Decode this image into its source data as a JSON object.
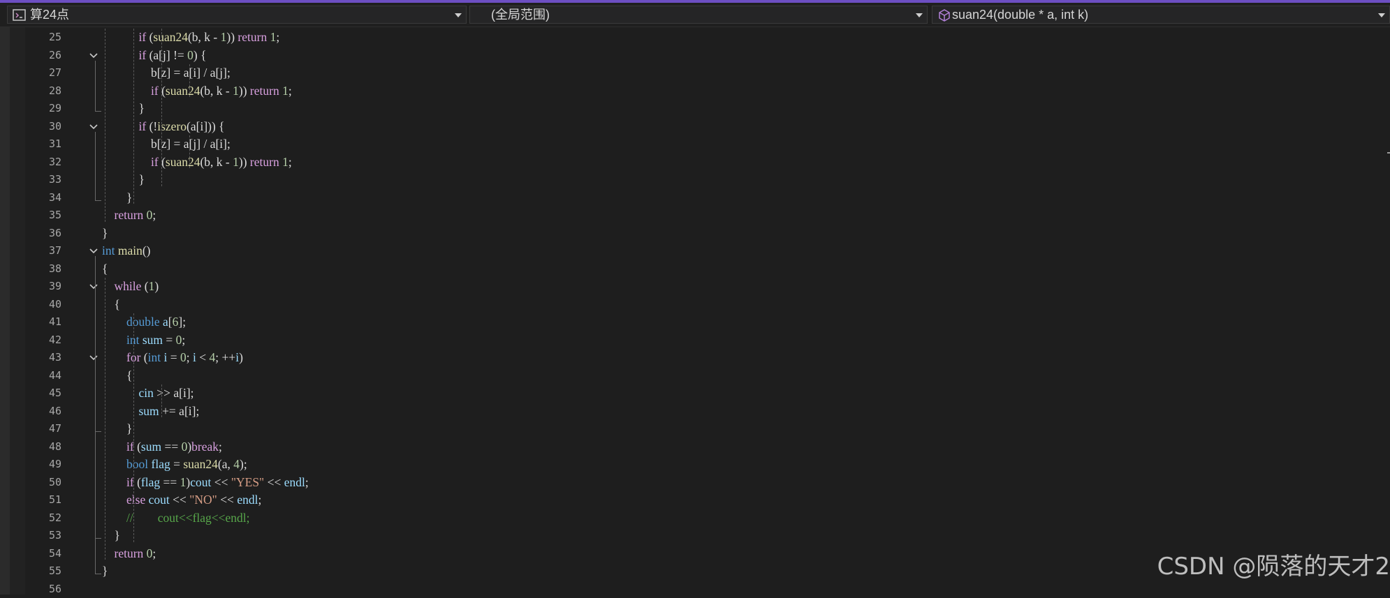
{
  "navbar": {
    "file_dropdown": "算24点",
    "scope_dropdown": "(全局范围)",
    "function_dropdown": "suan24(double * a, int k)"
  },
  "editor": {
    "lines": [
      {
        "n": "25",
        "fold": false,
        "tokens": [
          [
            "plain",
            "            "
          ],
          [
            "ctl",
            "if"
          ],
          [
            "plain",
            " ("
          ],
          [
            "fn",
            "suan24"
          ],
          [
            "plain",
            "(b, k - "
          ],
          [
            "num",
            "1"
          ],
          [
            "plain",
            ")) "
          ],
          [
            "ctl",
            "return"
          ],
          [
            "plain",
            " "
          ],
          [
            "num",
            "1"
          ],
          [
            "plain",
            ";"
          ]
        ]
      },
      {
        "n": "26",
        "fold": true,
        "tokens": [
          [
            "plain",
            "            "
          ],
          [
            "ctl",
            "if"
          ],
          [
            "plain",
            " (a[j] != "
          ],
          [
            "num",
            "0"
          ],
          [
            "plain",
            ") {"
          ]
        ]
      },
      {
        "n": "27",
        "fold": false,
        "tokens": [
          [
            "plain",
            "                b[z] = a[i] / a[j];"
          ]
        ]
      },
      {
        "n": "28",
        "fold": false,
        "tokens": [
          [
            "plain",
            "                "
          ],
          [
            "ctl",
            "if"
          ],
          [
            "plain",
            " ("
          ],
          [
            "fn",
            "suan24"
          ],
          [
            "plain",
            "(b, k - "
          ],
          [
            "num",
            "1"
          ],
          [
            "plain",
            ")) "
          ],
          [
            "ctl",
            "return"
          ],
          [
            "plain",
            " "
          ],
          [
            "num",
            "1"
          ],
          [
            "plain",
            ";"
          ]
        ]
      },
      {
        "n": "29",
        "fold": false,
        "tokens": [
          [
            "plain",
            "            }"
          ]
        ]
      },
      {
        "n": "30",
        "fold": true,
        "tokens": [
          [
            "plain",
            "            "
          ],
          [
            "ctl",
            "if"
          ],
          [
            "plain",
            " (!"
          ],
          [
            "fn",
            "iszero"
          ],
          [
            "plain",
            "(a[i])) {"
          ]
        ]
      },
      {
        "n": "31",
        "fold": false,
        "tokens": [
          [
            "plain",
            "                b[z] = a[j] / a[i];"
          ]
        ]
      },
      {
        "n": "32",
        "fold": false,
        "tokens": [
          [
            "plain",
            "                "
          ],
          [
            "ctl",
            "if"
          ],
          [
            "plain",
            " ("
          ],
          [
            "fn",
            "suan24"
          ],
          [
            "plain",
            "(b, k - "
          ],
          [
            "num",
            "1"
          ],
          [
            "plain",
            ")) "
          ],
          [
            "ctl",
            "return"
          ],
          [
            "plain",
            " "
          ],
          [
            "num",
            "1"
          ],
          [
            "plain",
            ";"
          ]
        ]
      },
      {
        "n": "33",
        "fold": false,
        "tokens": [
          [
            "plain",
            "            }"
          ]
        ]
      },
      {
        "n": "34",
        "fold": false,
        "tokens": [
          [
            "plain",
            "        }"
          ]
        ]
      },
      {
        "n": "35",
        "fold": false,
        "tokens": [
          [
            "plain",
            "    "
          ],
          [
            "ctl",
            "return"
          ],
          [
            "plain",
            " "
          ],
          [
            "num",
            "0"
          ],
          [
            "plain",
            ";"
          ]
        ]
      },
      {
        "n": "36",
        "fold": false,
        "tokens": [
          [
            "plain",
            "}"
          ]
        ]
      },
      {
        "n": "37",
        "fold": true,
        "tokens": [
          [
            "kw",
            "int"
          ],
          [
            "plain",
            " "
          ],
          [
            "fn",
            "main"
          ],
          [
            "plain",
            "()"
          ]
        ]
      },
      {
        "n": "38",
        "fold": false,
        "tokens": [
          [
            "plain",
            "{"
          ]
        ]
      },
      {
        "n": "39",
        "fold": true,
        "tokens": [
          [
            "plain",
            "    "
          ],
          [
            "ctl",
            "while"
          ],
          [
            "plain",
            " ("
          ],
          [
            "num",
            "1"
          ],
          [
            "plain",
            ")"
          ]
        ]
      },
      {
        "n": "40",
        "fold": false,
        "tokens": [
          [
            "plain",
            "    {"
          ]
        ]
      },
      {
        "n": "41",
        "fold": false,
        "tokens": [
          [
            "plain",
            "        "
          ],
          [
            "kw",
            "double"
          ],
          [
            "plain",
            " "
          ],
          [
            "var",
            "a"
          ],
          [
            "plain",
            "["
          ],
          [
            "num",
            "6"
          ],
          [
            "plain",
            "];"
          ]
        ]
      },
      {
        "n": "42",
        "fold": false,
        "tokens": [
          [
            "plain",
            "        "
          ],
          [
            "kw",
            "int"
          ],
          [
            "plain",
            " "
          ],
          [
            "var",
            "sum"
          ],
          [
            "plain",
            " = "
          ],
          [
            "num",
            "0"
          ],
          [
            "plain",
            ";"
          ]
        ]
      },
      {
        "n": "43",
        "fold": true,
        "tokens": [
          [
            "plain",
            "        "
          ],
          [
            "ctl",
            "for"
          ],
          [
            "plain",
            " ("
          ],
          [
            "kw",
            "int"
          ],
          [
            "plain",
            " "
          ],
          [
            "var",
            "i"
          ],
          [
            "plain",
            " = "
          ],
          [
            "num",
            "0"
          ],
          [
            "plain",
            "; "
          ],
          [
            "var",
            "i"
          ],
          [
            "plain",
            " < "
          ],
          [
            "num",
            "4"
          ],
          [
            "plain",
            "; ++"
          ],
          [
            "var",
            "i"
          ],
          [
            "plain",
            ")"
          ]
        ]
      },
      {
        "n": "44",
        "fold": false,
        "tokens": [
          [
            "plain",
            "        {"
          ]
        ]
      },
      {
        "n": "45",
        "fold": false,
        "tokens": [
          [
            "plain",
            "            "
          ],
          [
            "var",
            "cin"
          ],
          [
            "plain",
            " >> a[i];"
          ]
        ]
      },
      {
        "n": "46",
        "fold": false,
        "tokens": [
          [
            "plain",
            "            "
          ],
          [
            "var",
            "sum"
          ],
          [
            "plain",
            " += a[i];"
          ]
        ]
      },
      {
        "n": "47",
        "fold": false,
        "tokens": [
          [
            "plain",
            "        }"
          ]
        ]
      },
      {
        "n": "48",
        "fold": false,
        "tokens": [
          [
            "plain",
            "        "
          ],
          [
            "ctl",
            "if"
          ],
          [
            "plain",
            " ("
          ],
          [
            "var",
            "sum"
          ],
          [
            "plain",
            " == "
          ],
          [
            "num",
            "0"
          ],
          [
            "plain",
            ")"
          ],
          [
            "ctl",
            "break"
          ],
          [
            "plain",
            ";"
          ]
        ]
      },
      {
        "n": "49",
        "fold": false,
        "tokens": [
          [
            "plain",
            "        "
          ],
          [
            "kw",
            "bool"
          ],
          [
            "plain",
            " "
          ],
          [
            "var",
            "flag"
          ],
          [
            "plain",
            " = "
          ],
          [
            "fn",
            "suan24"
          ],
          [
            "plain",
            "(a, "
          ],
          [
            "num",
            "4"
          ],
          [
            "plain",
            ");"
          ]
        ]
      },
      {
        "n": "50",
        "fold": false,
        "tokens": [
          [
            "plain",
            "        "
          ],
          [
            "ctl",
            "if"
          ],
          [
            "plain",
            " ("
          ],
          [
            "var",
            "flag"
          ],
          [
            "plain",
            " == "
          ],
          [
            "num",
            "1"
          ],
          [
            "plain",
            ")"
          ],
          [
            "var",
            "cout"
          ],
          [
            "plain",
            " << "
          ],
          [
            "str",
            "\"YES\""
          ],
          [
            "plain",
            " << "
          ],
          [
            "var",
            "endl"
          ],
          [
            "plain",
            ";"
          ]
        ]
      },
      {
        "n": "51",
        "fold": false,
        "tokens": [
          [
            "plain",
            "        "
          ],
          [
            "ctl",
            "else"
          ],
          [
            "plain",
            " "
          ],
          [
            "var",
            "cout"
          ],
          [
            "plain",
            " << "
          ],
          [
            "str",
            "\"NO\""
          ],
          [
            "plain",
            " << "
          ],
          [
            "var",
            "endl"
          ],
          [
            "plain",
            ";"
          ]
        ]
      },
      {
        "n": "52",
        "fold": false,
        "tokens": [
          [
            "plain",
            "        "
          ],
          [
            "cmt",
            "//        cout<<flag<<endl;"
          ]
        ]
      },
      {
        "n": "53",
        "fold": false,
        "tokens": [
          [
            "plain",
            "    }"
          ]
        ]
      },
      {
        "n": "54",
        "fold": false,
        "tokens": [
          [
            "plain",
            "    "
          ],
          [
            "ctl",
            "return"
          ],
          [
            "plain",
            " "
          ],
          [
            "num",
            "0"
          ],
          [
            "plain",
            ";"
          ]
        ]
      },
      {
        "n": "55",
        "fold": false,
        "tokens": [
          [
            "plain",
            "}"
          ]
        ]
      },
      {
        "n": "56",
        "fold": false,
        "tokens": []
      }
    ]
  },
  "watermark": "CSDN @陨落的天才2"
}
